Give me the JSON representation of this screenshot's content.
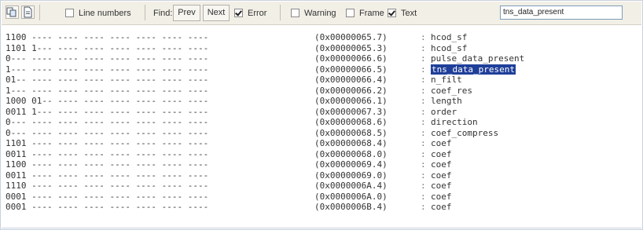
{
  "toolbar": {
    "line_numbers": {
      "label": "Line numbers",
      "checked": false
    },
    "find_label": "Find:",
    "prev_label": "Prev",
    "next_label": "Next",
    "error": {
      "label": "Error",
      "checked": true
    },
    "warning": {
      "label": "Warning",
      "checked": false
    },
    "frame": {
      "label": "Frame",
      "checked": false
    },
    "text": {
      "label": "Text",
      "checked": true
    },
    "search_value": "tns_data_present"
  },
  "rows": [
    {
      "bits": "1100 ---- ---- ---- ---- ---- ---- ----",
      "addr": "(0x00000065.7)",
      "name": "hcod_sf"
    },
    {
      "bits": "1101 1--- ---- ---- ---- ---- ---- ----",
      "addr": "(0x00000065.3)",
      "name": "hcod_sf"
    },
    {
      "bits": "0--- ---- ---- ---- ---- ---- ---- ----",
      "addr": "(0x00000066.6)",
      "name": "pulse_data_present"
    },
    {
      "bits": "1--- ---- ---- ---- ---- ---- ---- ----",
      "addr": "(0x00000066.5)",
      "name": "tns_data_present"
    },
    {
      "bits": "01-- ---- ---- ---- ---- ---- ---- ----",
      "addr": "(0x00000066.4)",
      "name": "n_filt"
    },
    {
      "bits": "1--- ---- ---- ---- ---- ---- ---- ----",
      "addr": "(0x00000066.2)",
      "name": "coef_res"
    },
    {
      "bits": "1000 01-- ---- ---- ---- ---- ---- ----",
      "addr": "(0x00000066.1)",
      "name": "length"
    },
    {
      "bits": "0011 1--- ---- ---- ---- ---- ---- ----",
      "addr": "(0x00000067.3)",
      "name": "order"
    },
    {
      "bits": "0--- ---- ---- ---- ---- ---- ---- ----",
      "addr": "(0x00000068.6)",
      "name": "direction"
    },
    {
      "bits": "0--- ---- ---- ---- ---- ---- ---- ----",
      "addr": "(0x00000068.5)",
      "name": "coef_compress"
    },
    {
      "bits": "1101 ---- ---- ---- ---- ---- ---- ----",
      "addr": "(0x00000068.4)",
      "name": "coef"
    },
    {
      "bits": "0011 ---- ---- ---- ---- ---- ---- ----",
      "addr": "(0x00000068.0)",
      "name": "coef"
    },
    {
      "bits": "1100 ---- ---- ---- ---- ---- ---- ----",
      "addr": "(0x00000069.4)",
      "name": "coef"
    },
    {
      "bits": "0011 ---- ---- ---- ---- ---- ---- ----",
      "addr": "(0x00000069.0)",
      "name": "coef"
    },
    {
      "bits": "1110 ---- ---- ---- ---- ---- ---- ----",
      "addr": "(0x0000006A.4)",
      "name": "coef"
    },
    {
      "bits": "0001 ---- ---- ---- ---- ---- ---- ----",
      "addr": "(0x0000006A.0)",
      "name": "coef"
    },
    {
      "bits": "0001 ---- ---- ---- ---- ---- ---- ----",
      "addr": "(0x0000006B.4)",
      "name": "coef"
    }
  ],
  "selected_row": 3,
  "colors": {
    "selection": "#1f3f99",
    "toolbar": "#f1efe6"
  },
  "icons": [
    "copy-icon",
    "document-icon"
  ]
}
